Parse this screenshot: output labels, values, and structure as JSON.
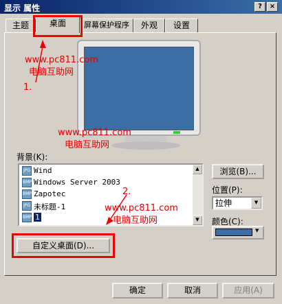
{
  "window": {
    "title": "显示 属性",
    "help_label": "?",
    "close_label": "×"
  },
  "tabs": [
    "主题",
    "桌面",
    "屏幕保护程序",
    "外观",
    "设置"
  ],
  "watermark": {
    "url": "www.pc811.com",
    "site": "电脑互助网"
  },
  "annotations": {
    "step1": "1.",
    "step2": "2."
  },
  "background": {
    "label": "背景(K):",
    "items": [
      {
        "name": "Wind",
        "type": "JPG"
      },
      {
        "name": "Windows Server 2003",
        "type": "BMP"
      },
      {
        "name": "Zapotec",
        "type": "BMP"
      },
      {
        "name": "未标题-1",
        "type": "JPG"
      },
      {
        "name": "1",
        "type": "BMP",
        "selected": true
      }
    ]
  },
  "browse_label": "浏览(B)...",
  "position": {
    "label": "位置(P):",
    "value": "拉伸"
  },
  "color": {
    "label": "颜色(C):",
    "swatch": "#3a6ea5"
  },
  "customize_label": "自定义桌面(D)...",
  "footer": {
    "ok": "确定",
    "cancel": "取消",
    "apply": "应用(A)"
  },
  "colors": {
    "accent_red": "#e60000",
    "titlebar": "#0a246a",
    "monitor_screen": "#3a6ea5"
  }
}
